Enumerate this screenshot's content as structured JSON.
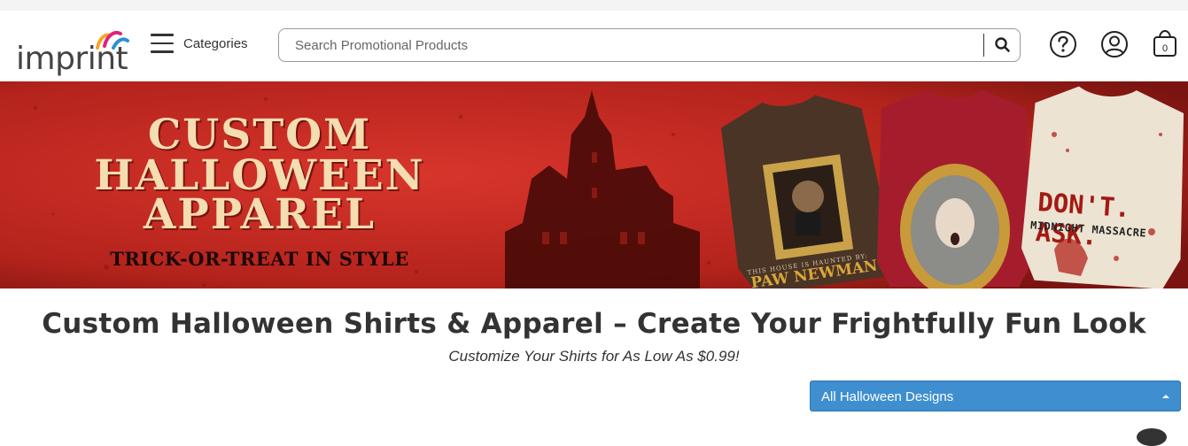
{
  "header": {
    "logo_text": "imprint",
    "categories_label": "Categories",
    "search_placeholder": "Search Promotional Products",
    "icons": [
      "menu-icon",
      "search-icon",
      "help-icon",
      "account-icon",
      "cart-icon"
    ],
    "cart_count": "0"
  },
  "banner": {
    "title_line1": "CUSTOM",
    "title_line2": "HALLOWEEN",
    "title_line3": "APPAREL",
    "tagline": "TRICK-OR-TREAT IN STYLE",
    "shirt1_line1": "THIS HOUSE IS HAUNTED BY:",
    "shirt1_line2": "PAW NEWMAN",
    "shirt3_line1": "DON'T. ASK.",
    "shirt3_line2": "MIDNIGHT MASSACRE"
  },
  "main": {
    "title": "Custom Halloween Shirts & Apparel – Create Your Frightfully Fun Look",
    "subtitle": "Customize Your Shirts for As Low As $0.99!",
    "design_filter_selected": "All Halloween Designs"
  },
  "colors": {
    "banner_red": "#c52a23",
    "banner_text": "#f4ddb0",
    "select_blue": "#3f8fd0"
  }
}
